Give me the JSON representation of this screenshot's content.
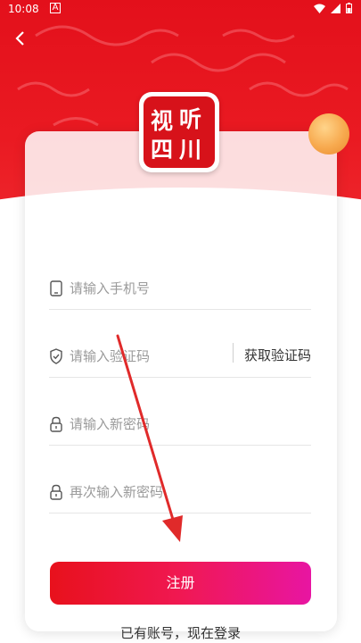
{
  "status_bar": {
    "time": "10:08",
    "notification_glyph": "A"
  },
  "logo": {
    "chars": [
      "视",
      "听",
      "四",
      "川"
    ]
  },
  "form": {
    "phone_placeholder": "请输入手机号",
    "code_placeholder": "请输入验证码",
    "get_code_label": "获取验证码",
    "password_placeholder": "请输入新密码",
    "confirm_password_placeholder": "再次输入新密码",
    "register_label": "注册",
    "login_link": "已有账号，现在登录"
  },
  "colors": {
    "brand_red": "#e3101b",
    "button_gradient_start": "#e8111c",
    "button_gradient_end": "#e815a2",
    "annotation_arrow": "#e02a2a"
  },
  "icons": [
    "back-arrow-icon",
    "wifi-icon",
    "signal-icon",
    "battery-icon",
    "phone-icon",
    "shield-icon",
    "lock-icon"
  ]
}
